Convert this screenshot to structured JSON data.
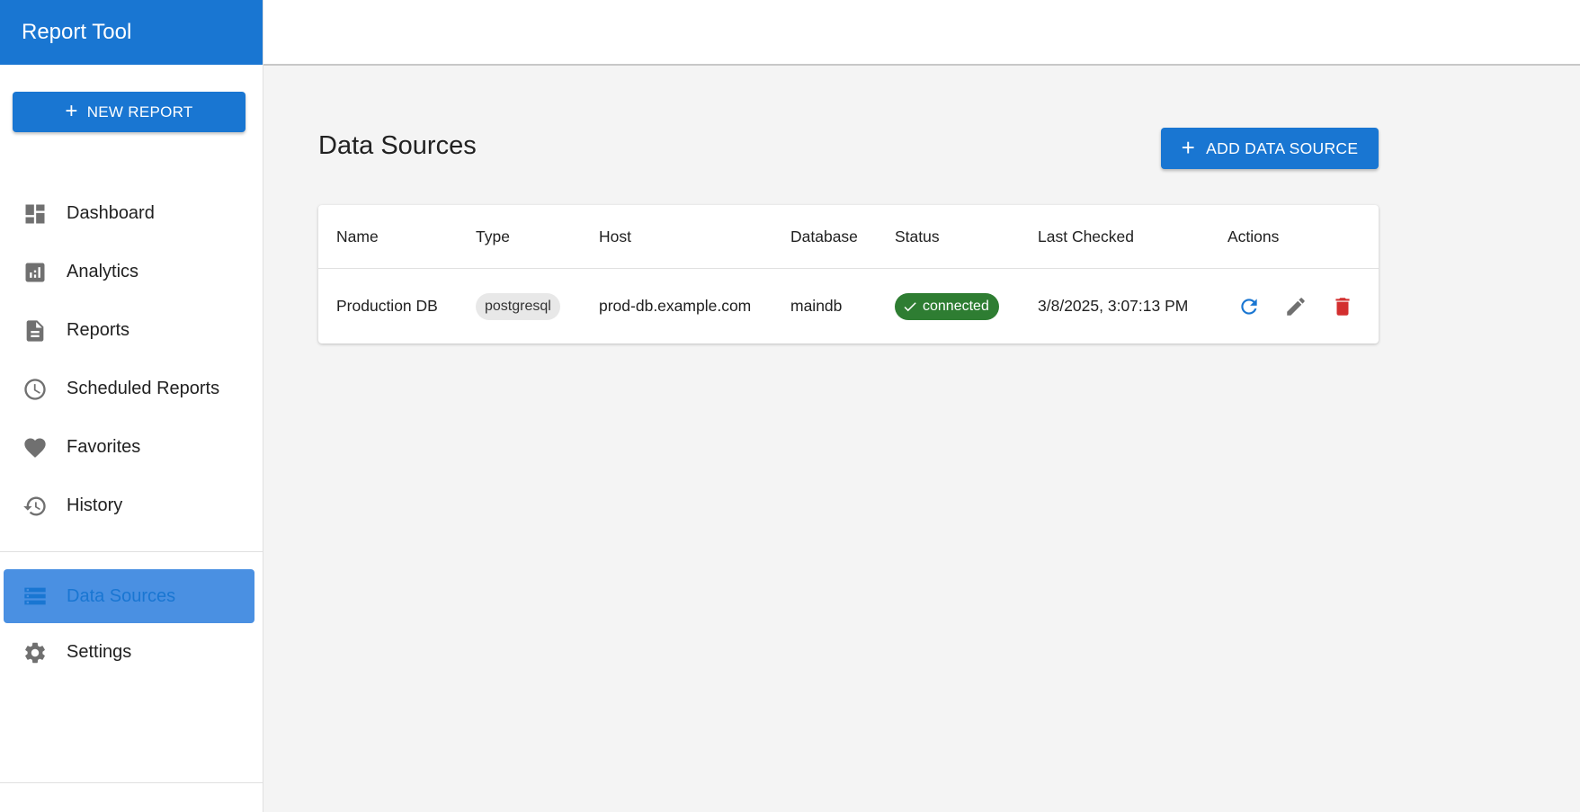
{
  "app": {
    "title": "Report Tool"
  },
  "sidebar": {
    "new_report_label": "NEW REPORT",
    "items": [
      {
        "label": "Dashboard",
        "icon": "dashboard-icon"
      },
      {
        "label": "Analytics",
        "icon": "analytics-icon"
      },
      {
        "label": "Reports",
        "icon": "document-icon"
      },
      {
        "label": "Scheduled Reports",
        "icon": "clock-icon"
      },
      {
        "label": "Favorites",
        "icon": "heart-icon"
      },
      {
        "label": "History",
        "icon": "history-icon"
      }
    ],
    "secondary_items": [
      {
        "label": "Data Sources",
        "icon": "storage-icon",
        "active": true
      },
      {
        "label": "Settings",
        "icon": "gear-icon"
      }
    ]
  },
  "main": {
    "title": "Data Sources",
    "add_button_label": "ADD DATA SOURCE",
    "table": {
      "columns": [
        "Name",
        "Type",
        "Host",
        "Database",
        "Status",
        "Last Checked",
        "Actions"
      ],
      "rows": [
        {
          "name": "Production DB",
          "type": "postgresql",
          "host": "prod-db.example.com",
          "database": "maindb",
          "status": "connected",
          "last_checked": "3/8/2025, 3:07:13 PM"
        }
      ]
    }
  },
  "colors": {
    "primary": "#1976d2",
    "active_nav_bg": "#4a90e2",
    "status_connected": "#2e7d32",
    "delete": "#d32f2f",
    "icon_gray": "#707070"
  }
}
